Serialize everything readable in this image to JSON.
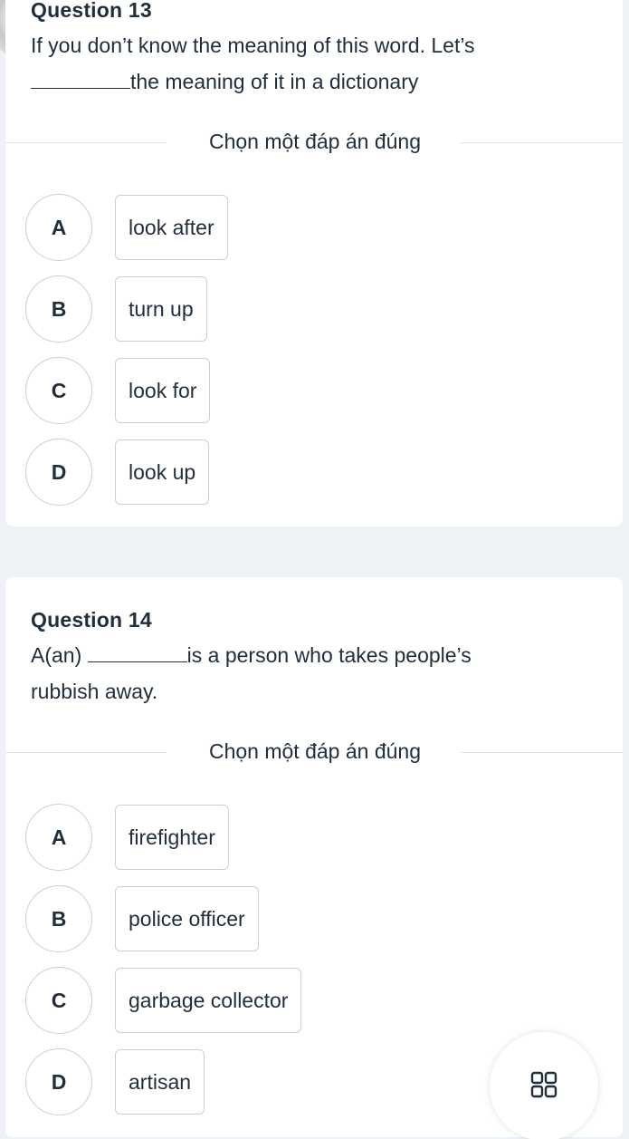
{
  "questions": [
    {
      "title": "Question 13",
      "text_before": "If you don’t know the meaning of this word. Let’s",
      "text_after": "the meaning of it in a dictionary",
      "prompt": "Chọn một đáp án đúng",
      "options": [
        {
          "letter": "A",
          "text": "look after"
        },
        {
          "letter": "B",
          "text": "turn up"
        },
        {
          "letter": "C",
          "text": "look for"
        },
        {
          "letter": "D",
          "text": "look up"
        }
      ]
    },
    {
      "title": "Question 14",
      "text_before": "A(an)",
      "text_after": "is a person who takes people’s",
      "text_line2": "rubbish away.",
      "prompt": "Chọn một đáp án đúng",
      "options": [
        {
          "letter": "A",
          "text": "firefighter"
        },
        {
          "letter": "B",
          "text": "police officer"
        },
        {
          "letter": "C",
          "text": "garbage collector"
        },
        {
          "letter": "D",
          "text": "artisan"
        }
      ]
    }
  ],
  "floating_button": {
    "icon": "grid-icon"
  }
}
